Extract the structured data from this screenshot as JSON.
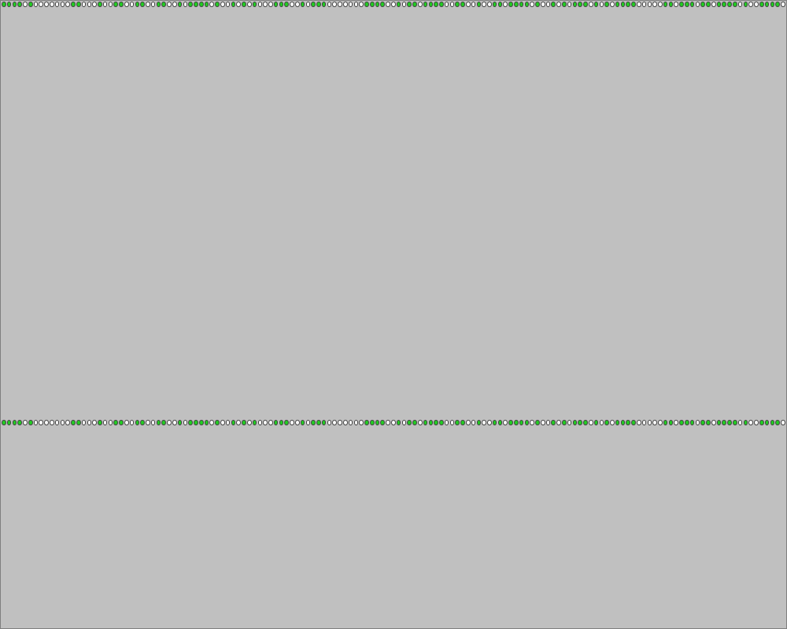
{
  "colors": {
    "background": "#c0c0c0",
    "led_on": "#22cc22",
    "led_off": "#ffffff",
    "led_border": "#444444"
  },
  "led_row_top": {
    "icon": "led-indicator-icon",
    "states": "111101000000011000100110011001100101111010010101000111001011100000001111001011011110011001001101111010010101110101011110000011011101101111010011110011000110110101111011100000111000110011101111110101010101000110111110110001111011000111101010010010010111"
  },
  "led_row_bottom": {
    "icon": "led-indicator-icon",
    "states": "111101000000011000100110011001100101111010010101000111001011100000001111001011011110011001001101111010010101110101011110000011011101101111010011110011000110110101111011100000111000110011101111110101010101000110111110110001111011000111101010010010010111"
  }
}
